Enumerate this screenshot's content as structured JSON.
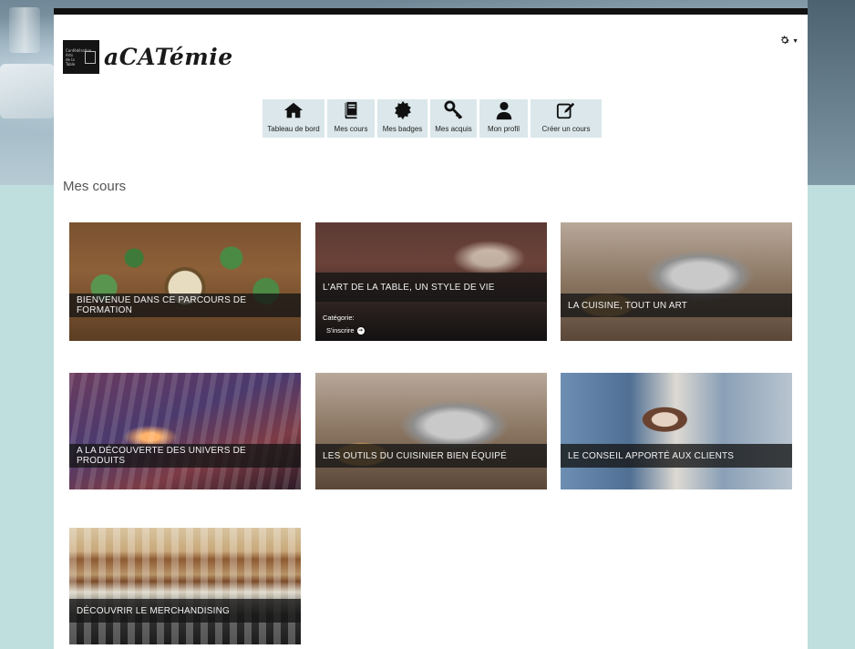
{
  "header": {
    "logo_text": "aCATémie",
    "logo_small_lines": [
      "Confédération",
      "Arts",
      "de la",
      "Table"
    ]
  },
  "nav": [
    {
      "label": "Tableau de bord",
      "icon": "home-icon"
    },
    {
      "label": "Mes cours",
      "icon": "book-icon"
    },
    {
      "label": "Mes badges",
      "icon": "badge-icon"
    },
    {
      "label": "Mes acquis",
      "icon": "key-icon"
    },
    {
      "label": "Mon profil",
      "icon": "user-icon"
    },
    {
      "label": "Créer un cours",
      "icon": "edit-icon"
    }
  ],
  "section": {
    "title": "Mes cours"
  },
  "courses": [
    {
      "title": "BIENVENUE DANS CE PARCOURS DE FORMATION"
    },
    {
      "title": "L'ART DE LA TABLE, UN STYLE DE VIE",
      "category_label": "Catégorie:",
      "enroll_label": "S'inscrire"
    },
    {
      "title": "LA CUISINE, TOUT UN ART"
    },
    {
      "title": "A LA DÉCOUVERTE DES UNIVERS DE PRODUITS"
    },
    {
      "title": "LES OUTILS DU CUISINIER BIEN ÉQUIPÉ"
    },
    {
      "title": "LE CONSEIL APPORTÉ AUX CLIENTS"
    },
    {
      "title": "DÉCOUVRIR LE MERCHANDISING"
    }
  ],
  "colors": {
    "accent_bar": "#111111",
    "nav_tile_bg": "#dbe7ea",
    "page_bg": "#bfdede"
  }
}
